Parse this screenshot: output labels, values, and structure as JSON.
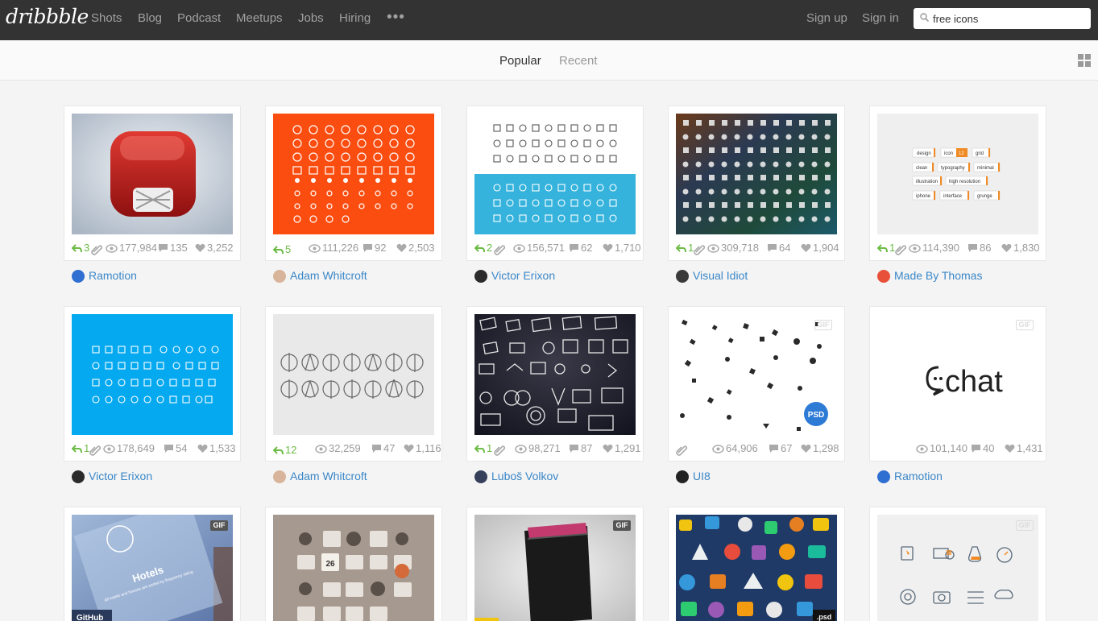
{
  "brand": {
    "logo_text": "dribbble"
  },
  "nav": {
    "items": [
      "Shots",
      "Blog",
      "Podcast",
      "Meetups",
      "Jobs",
      "Hiring"
    ],
    "more_label": "•••",
    "sign_up": "Sign up",
    "sign_in": "Sign in"
  },
  "search": {
    "value": "free icons"
  },
  "tabs": {
    "popular": "Popular",
    "recent": "Recent"
  },
  "colors": {
    "header_bg": "#333333",
    "link": "#3a87c8",
    "rebound": "#6cbb45",
    "stat": "#9a9a9a"
  },
  "shots": [
    {
      "author": "Ramotion",
      "rebounds": "3",
      "views": "177,984",
      "comments": "135",
      "likes": "3,252",
      "has_attachment": true,
      "gif": false
    },
    {
      "author": "Adam Whitcroft",
      "rebounds": "5",
      "views": "111,226",
      "comments": "92",
      "likes": "2,503",
      "has_attachment": false,
      "gif": false
    },
    {
      "author": "Victor Erixon",
      "rebounds": "2",
      "views": "156,571",
      "comments": "62",
      "likes": "1,710",
      "has_attachment": true,
      "gif": false
    },
    {
      "author": "Visual Idiot",
      "rebounds": "1",
      "views": "309,718",
      "comments": "64",
      "likes": "1,904",
      "has_attachment": true,
      "gif": false
    },
    {
      "author": "Made By Thomas",
      "rebounds": "1",
      "views": "114,390",
      "comments": "86",
      "likes": "1,830",
      "has_attachment": true,
      "gif": false,
      "tags": [
        "design",
        "icon",
        "12",
        "grid",
        "clean",
        "typography",
        "minimal",
        "illustration",
        "high resolution",
        "iphone",
        "interface",
        "grunge"
      ]
    },
    {
      "author": "Victor Erixon",
      "rebounds": "1",
      "views": "178,649",
      "comments": "54",
      "likes": "1,533",
      "has_attachment": true,
      "gif": false
    },
    {
      "author": "Adam Whitcroft",
      "rebounds": "12",
      "views": "32,259",
      "comments": "47",
      "likes": "1,116",
      "has_attachment": false,
      "gif": false
    },
    {
      "author": "Luboš Volkov",
      "rebounds": "1",
      "views": "98,271",
      "comments": "87",
      "likes": "1,291",
      "has_attachment": true,
      "gif": false
    },
    {
      "author": "UI8",
      "rebounds": "",
      "views": "64,906",
      "comments": "67",
      "likes": "1,298",
      "has_attachment": true,
      "gif": true,
      "badge": "PSD"
    },
    {
      "author": "Ramotion",
      "rebounds": "",
      "views": "101,140",
      "comments": "40",
      "likes": "1,431",
      "has_attachment": false,
      "gif": true,
      "thumb_text": "chat"
    },
    {
      "gif": true,
      "gif_label": "GIF",
      "thumb_text": "Hotels",
      "sub_text": "GitHub",
      "caption": "All hotels and houses are sorted by frequency rating"
    },
    {
      "gif": false,
      "calendar_day": "26"
    },
    {
      "gif": true,
      "gif_label": "GIF"
    },
    {
      "gif": false,
      "badge": ".psd"
    },
    {
      "gif": true,
      "gif_label": "GIF"
    }
  ],
  "gif_label": "GIF"
}
